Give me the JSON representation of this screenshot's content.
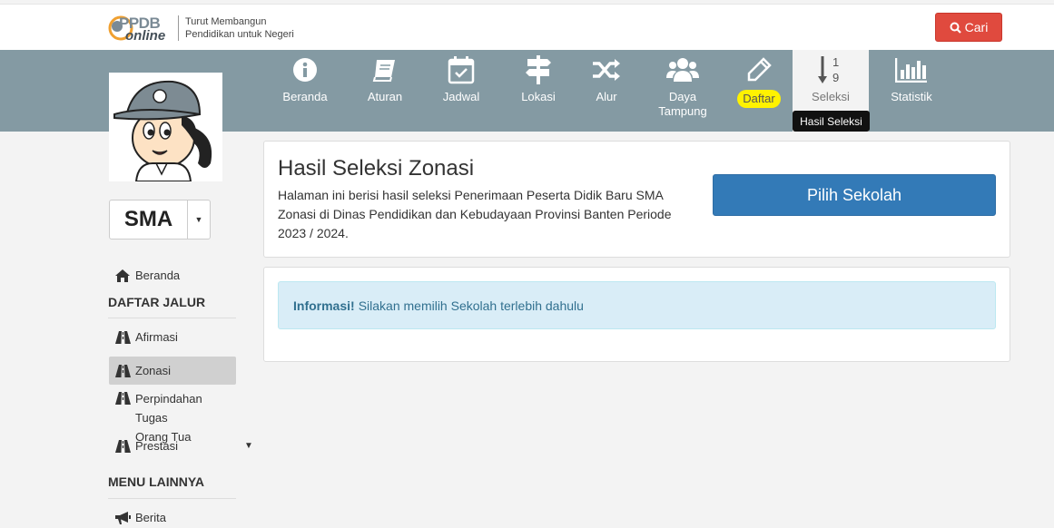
{
  "header": {
    "logo_top": "PPDB",
    "logo_bottom": "online",
    "tagline_line1": "Turut Membangun",
    "tagline_line2": "Pendidikan untuk Negeri",
    "search_label": "Cari"
  },
  "nav": {
    "items": [
      {
        "label": "Beranda",
        "icon": "info-circle-icon"
      },
      {
        "label": "Aturan",
        "icon": "book-icon"
      },
      {
        "label": "Jadwal",
        "icon": "calendar-check-icon"
      },
      {
        "label": "Lokasi",
        "icon": "signpost-icon"
      },
      {
        "label": "Alur",
        "icon": "random-icon"
      },
      {
        "label": "Daya",
        "label2": "Tampung",
        "icon": "users-icon"
      },
      {
        "label": "Daftar",
        "icon": "pencil-icon"
      },
      {
        "label": "Seleksi",
        "icon": "sort-numeric-icon"
      },
      {
        "label": "Statistik",
        "icon": "bar-chart-icon"
      }
    ],
    "tooltip": "Hasil Seleksi",
    "highlight_color": "#fff200"
  },
  "school_level": {
    "selected": "SMA"
  },
  "sidebar": {
    "home": "Beranda",
    "section1": "DAFTAR JALUR",
    "jalur": [
      "Afirmasi",
      "Zonasi",
      "Perpindahan Tugas",
      "Orang Tua",
      "Prestasi"
    ],
    "section2": "MENU LAINNYA",
    "berita": "Berita"
  },
  "main": {
    "title": "Hasil Seleksi Zonasi",
    "desc_line1": "Halaman ini berisi hasil seleksi Penerimaan Peserta Didik Baru SMA",
    "desc_line2": "Zonasi di Dinas Pendidikan dan Kebudayaan Provinsi Banten Periode",
    "desc_line3": "2023 / 2024.",
    "pilih_button": "Pilih Sekolah",
    "alert_strong": "Informasi!",
    "alert_text": "Silakan memilih Sekolah terlebih dahulu"
  },
  "colors": {
    "nav_band": "#849aa3",
    "primary": "#337ab7",
    "danger": "#e04a3e",
    "info_bg": "#d9edf7"
  }
}
